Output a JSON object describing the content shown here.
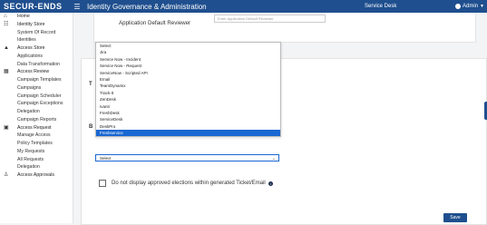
{
  "header": {
    "logo": "SECUR-ENDS",
    "title": "Identity Governance & Administration",
    "service_desk": "Service Desk",
    "admin": "Admin"
  },
  "sidebar": {
    "items": [
      {
        "label": "Home",
        "icon": "home-icon",
        "header": true
      },
      {
        "label": "Identity Store",
        "icon": "users-icon",
        "header": true
      },
      {
        "label": "System Of Record"
      },
      {
        "label": "Identities"
      },
      {
        "label": "Access Store",
        "icon": "person-icon",
        "header": true
      },
      {
        "label": "Applications"
      },
      {
        "label": "Data Transformation"
      },
      {
        "label": "Access Review",
        "icon": "grid-icon",
        "header": true
      },
      {
        "label": "Campaign Templates"
      },
      {
        "label": "Campaigns"
      },
      {
        "label": "Campaign Scheduler"
      },
      {
        "label": "Campaign Exceptions"
      },
      {
        "label": "Delegation"
      },
      {
        "label": "Campaign Reports"
      },
      {
        "label": "Access Request",
        "icon": "lock-icon",
        "header": true
      },
      {
        "label": "Manage Access"
      },
      {
        "label": "Policy Templates"
      },
      {
        "label": "My Requests"
      },
      {
        "label": "All Requests"
      },
      {
        "label": "Delegation"
      },
      {
        "label": "Access Approvals",
        "icon": "approval-icon",
        "header": true
      }
    ]
  },
  "reviewer": {
    "label": "Application Default Reviewer",
    "placeholder": "Enter Application Default Reviewer"
  },
  "dropdown": {
    "options": [
      "Select",
      "Jira",
      "Service Now - Incident",
      "Service Now - Request",
      "ServiceNow - Scripted API",
      "Email",
      "TeamDynamix",
      "Track-It",
      "ZenDesk",
      "Ivanti",
      "FreshDesk",
      "ServiceDesk",
      "DeskPro",
      "Freshservice"
    ],
    "selected_index": 13,
    "current_value": "Select"
  },
  "checkbox": {
    "label": "Do not display approved elections within generated Ticket/Email"
  },
  "save_label": "Save",
  "section_chars": {
    "t": "T",
    "b": "B"
  }
}
